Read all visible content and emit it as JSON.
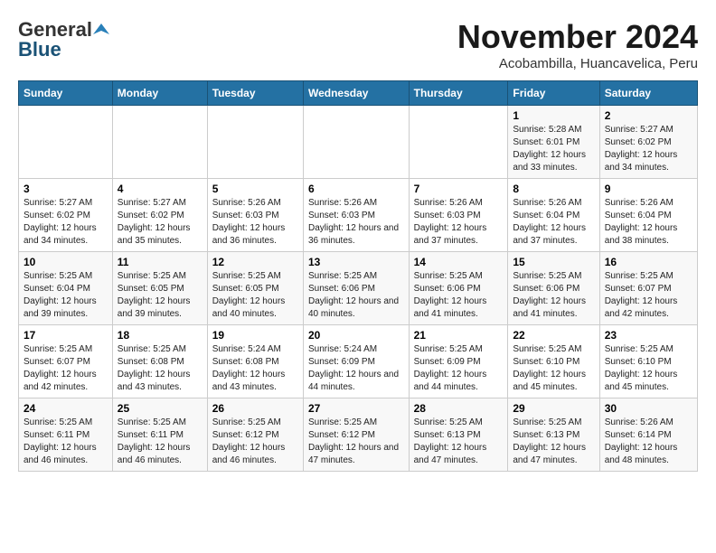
{
  "logo": {
    "general": "General",
    "blue": "Blue"
  },
  "header": {
    "month": "November 2024",
    "location": "Acobambilla, Huancavelica, Peru"
  },
  "weekdays": [
    "Sunday",
    "Monday",
    "Tuesday",
    "Wednesday",
    "Thursday",
    "Friday",
    "Saturday"
  ],
  "weeks": [
    [
      {
        "day": "",
        "content": ""
      },
      {
        "day": "",
        "content": ""
      },
      {
        "day": "",
        "content": ""
      },
      {
        "day": "",
        "content": ""
      },
      {
        "day": "",
        "content": ""
      },
      {
        "day": "1",
        "content": "Sunrise: 5:28 AM\nSunset: 6:01 PM\nDaylight: 12 hours and 33 minutes."
      },
      {
        "day": "2",
        "content": "Sunrise: 5:27 AM\nSunset: 6:02 PM\nDaylight: 12 hours and 34 minutes."
      }
    ],
    [
      {
        "day": "3",
        "content": "Sunrise: 5:27 AM\nSunset: 6:02 PM\nDaylight: 12 hours and 34 minutes."
      },
      {
        "day": "4",
        "content": "Sunrise: 5:27 AM\nSunset: 6:02 PM\nDaylight: 12 hours and 35 minutes."
      },
      {
        "day": "5",
        "content": "Sunrise: 5:26 AM\nSunset: 6:03 PM\nDaylight: 12 hours and 36 minutes."
      },
      {
        "day": "6",
        "content": "Sunrise: 5:26 AM\nSunset: 6:03 PM\nDaylight: 12 hours and 36 minutes."
      },
      {
        "day": "7",
        "content": "Sunrise: 5:26 AM\nSunset: 6:03 PM\nDaylight: 12 hours and 37 minutes."
      },
      {
        "day": "8",
        "content": "Sunrise: 5:26 AM\nSunset: 6:04 PM\nDaylight: 12 hours and 37 minutes."
      },
      {
        "day": "9",
        "content": "Sunrise: 5:26 AM\nSunset: 6:04 PM\nDaylight: 12 hours and 38 minutes."
      }
    ],
    [
      {
        "day": "10",
        "content": "Sunrise: 5:25 AM\nSunset: 6:04 PM\nDaylight: 12 hours and 39 minutes."
      },
      {
        "day": "11",
        "content": "Sunrise: 5:25 AM\nSunset: 6:05 PM\nDaylight: 12 hours and 39 minutes."
      },
      {
        "day": "12",
        "content": "Sunrise: 5:25 AM\nSunset: 6:05 PM\nDaylight: 12 hours and 40 minutes."
      },
      {
        "day": "13",
        "content": "Sunrise: 5:25 AM\nSunset: 6:06 PM\nDaylight: 12 hours and 40 minutes."
      },
      {
        "day": "14",
        "content": "Sunrise: 5:25 AM\nSunset: 6:06 PM\nDaylight: 12 hours and 41 minutes."
      },
      {
        "day": "15",
        "content": "Sunrise: 5:25 AM\nSunset: 6:06 PM\nDaylight: 12 hours and 41 minutes."
      },
      {
        "day": "16",
        "content": "Sunrise: 5:25 AM\nSunset: 6:07 PM\nDaylight: 12 hours and 42 minutes."
      }
    ],
    [
      {
        "day": "17",
        "content": "Sunrise: 5:25 AM\nSunset: 6:07 PM\nDaylight: 12 hours and 42 minutes."
      },
      {
        "day": "18",
        "content": "Sunrise: 5:25 AM\nSunset: 6:08 PM\nDaylight: 12 hours and 43 minutes."
      },
      {
        "day": "19",
        "content": "Sunrise: 5:24 AM\nSunset: 6:08 PM\nDaylight: 12 hours and 43 minutes."
      },
      {
        "day": "20",
        "content": "Sunrise: 5:24 AM\nSunset: 6:09 PM\nDaylight: 12 hours and 44 minutes."
      },
      {
        "day": "21",
        "content": "Sunrise: 5:25 AM\nSunset: 6:09 PM\nDaylight: 12 hours and 44 minutes."
      },
      {
        "day": "22",
        "content": "Sunrise: 5:25 AM\nSunset: 6:10 PM\nDaylight: 12 hours and 45 minutes."
      },
      {
        "day": "23",
        "content": "Sunrise: 5:25 AM\nSunset: 6:10 PM\nDaylight: 12 hours and 45 minutes."
      }
    ],
    [
      {
        "day": "24",
        "content": "Sunrise: 5:25 AM\nSunset: 6:11 PM\nDaylight: 12 hours and 46 minutes."
      },
      {
        "day": "25",
        "content": "Sunrise: 5:25 AM\nSunset: 6:11 PM\nDaylight: 12 hours and 46 minutes."
      },
      {
        "day": "26",
        "content": "Sunrise: 5:25 AM\nSunset: 6:12 PM\nDaylight: 12 hours and 46 minutes."
      },
      {
        "day": "27",
        "content": "Sunrise: 5:25 AM\nSunset: 6:12 PM\nDaylight: 12 hours and 47 minutes."
      },
      {
        "day": "28",
        "content": "Sunrise: 5:25 AM\nSunset: 6:13 PM\nDaylight: 12 hours and 47 minutes."
      },
      {
        "day": "29",
        "content": "Sunrise: 5:25 AM\nSunset: 6:13 PM\nDaylight: 12 hours and 47 minutes."
      },
      {
        "day": "30",
        "content": "Sunrise: 5:26 AM\nSunset: 6:14 PM\nDaylight: 12 hours and 48 minutes."
      }
    ]
  ]
}
